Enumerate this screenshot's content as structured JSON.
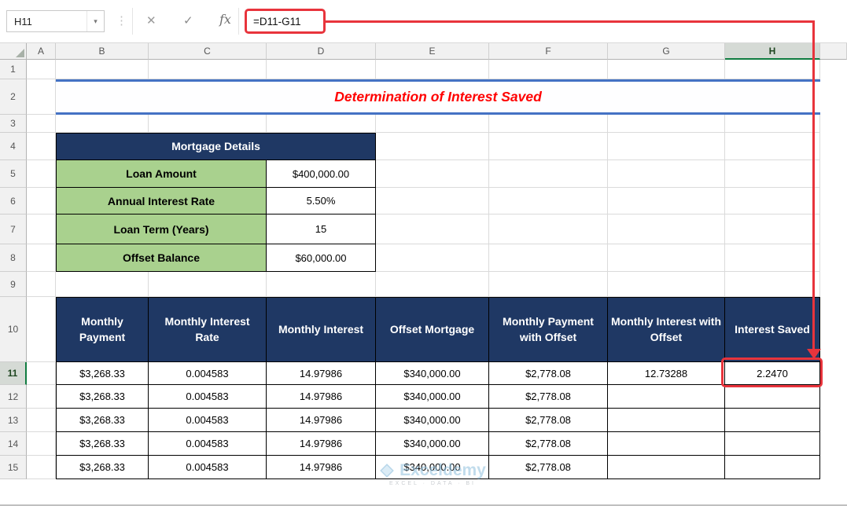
{
  "toolbar": {
    "name_box": "H11",
    "dropdown_icon": "▾",
    "dots_icon": "⋮",
    "cancel_icon": "✕",
    "enter_icon": "✓",
    "fx_icon": "fx",
    "formula": "=D11-G11"
  },
  "grid": {
    "columns": [
      "A",
      "B",
      "C",
      "D",
      "E",
      "F",
      "G",
      "H"
    ],
    "rows": [
      "1",
      "2",
      "3",
      "4",
      "5",
      "6",
      "7",
      "8",
      "9",
      "10",
      "11",
      "12",
      "13",
      "14",
      "15"
    ],
    "selected_column": "H",
    "selected_row": "11",
    "selected_cell": "H11"
  },
  "title": {
    "text": "Determination of Interest Saved"
  },
  "mortgage": {
    "header": "Mortgage Details",
    "rows": [
      {
        "label": "Loan Amount",
        "value": "$400,000.00"
      },
      {
        "label": "Annual Interest Rate",
        "value": "5.50%"
      },
      {
        "label": "Loan Term (Years)",
        "value": "15"
      },
      {
        "label": "Offset Balance",
        "value": "$60,000.00"
      }
    ]
  },
  "table": {
    "headers": [
      "Monthly Payment",
      "Monthly Interest Rate",
      "Monthly Interest",
      "Offset Mortgage",
      "Monthly Payment with Offset",
      "Monthly Interest with Offset",
      "Interest Saved"
    ],
    "rows": [
      [
        "$3,268.33",
        "0.004583",
        "14.97986",
        "$340,000.00",
        "$2,778.08",
        "12.73288",
        "2.2470"
      ],
      [
        "$3,268.33",
        "0.004583",
        "14.97986",
        "$340,000.00",
        "$2,778.08",
        "",
        ""
      ],
      [
        "$3,268.33",
        "0.004583",
        "14.97986",
        "$340,000.00",
        "$2,778.08",
        "",
        ""
      ],
      [
        "$3,268.33",
        "0.004583",
        "14.97986",
        "$340,000.00",
        "$2,778.08",
        "",
        ""
      ],
      [
        "$3,268.33",
        "0.004583",
        "14.97986",
        "$340,000.00",
        "$2,778.08",
        "",
        ""
      ]
    ]
  },
  "watermark": {
    "brand": "Exceldemy",
    "tagline": "EXCEL · DATA · BI"
  },
  "colors": {
    "navy": "#1F3864",
    "green": "#A9D18E",
    "title_red": "#FF0000",
    "annotation_red": "#E8343C",
    "accent_blue": "#4472C4",
    "select_green": "#107C41",
    "grid_line": "#DADADA"
  }
}
